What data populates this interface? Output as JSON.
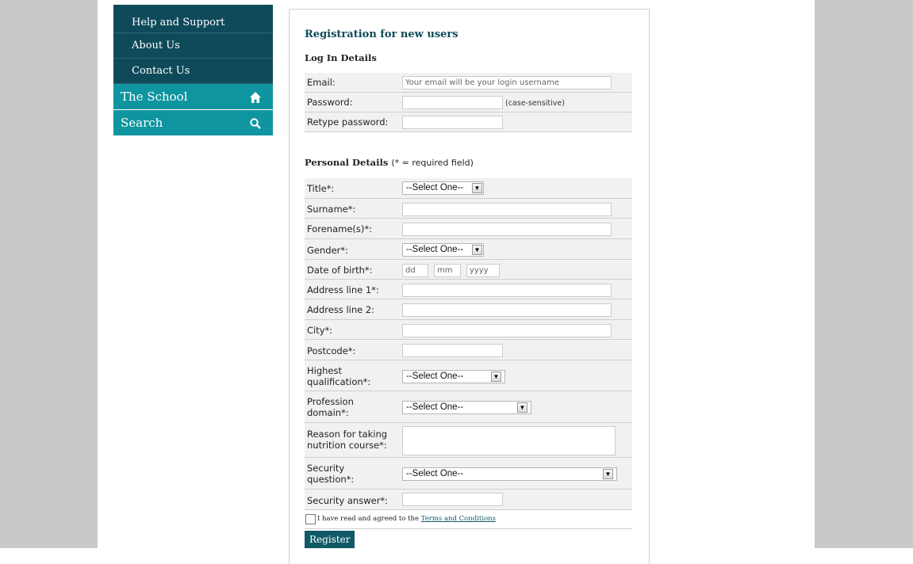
{
  "sidebar": {
    "items": [
      {
        "label": "Help and Support"
      },
      {
        "label": "About Us"
      },
      {
        "label": "Contact Us"
      }
    ],
    "categories": [
      {
        "label": "The School",
        "icon": "home-icon"
      },
      {
        "label": "Search",
        "icon": "search-icon"
      }
    ]
  },
  "form": {
    "title": "Registration for new users",
    "login_section": "Log In Details",
    "email_label": "Email:",
    "email_placeholder": "Your email will be your login username",
    "password_label": "Password:",
    "password_hint": "(case-sensitive)",
    "retype_label": "Retype password:",
    "personal_section": "Personal Details",
    "personal_note": "(* = required field)",
    "title_label": "Title*:",
    "title_value": "--Select One--",
    "surname_label": "Surname*:",
    "forename_label": "Forename(s)*:",
    "gender_label": "Gender*:",
    "gender_value": "--Select One--",
    "dob_label": "Date of birth*:",
    "dob_dd": "dd",
    "dob_mm": "mm",
    "dob_yyyy": "yyyy",
    "address1_label": "Address line 1*:",
    "address2_label": "Address line 2:",
    "city_label": "City*:",
    "postcode_label": "Postcode*:",
    "qualification_label_1": "Highest",
    "qualification_label_2": "qualification*:",
    "qualification_value": "--Select One--",
    "profession_label_1": "Profession",
    "profession_label_2": "domain*:",
    "profession_value": "--Select One--",
    "reason_label_1": "Reason for taking",
    "reason_label_2": "nutrition course*:",
    "security_q_label_1": "Security",
    "security_q_label_2": "question*:",
    "security_q_value": "--Select One--",
    "security_a_label": "Security answer*:",
    "terms_text": "I have read and agreed to the",
    "terms_link": "Terms and Conditions",
    "register_label": "Register"
  },
  "colors": {
    "nav_dark": "#0f4a5a",
    "nav_teal": "#0f95a0",
    "gutter": "#c9c9c9",
    "button": "#0f5a66"
  }
}
